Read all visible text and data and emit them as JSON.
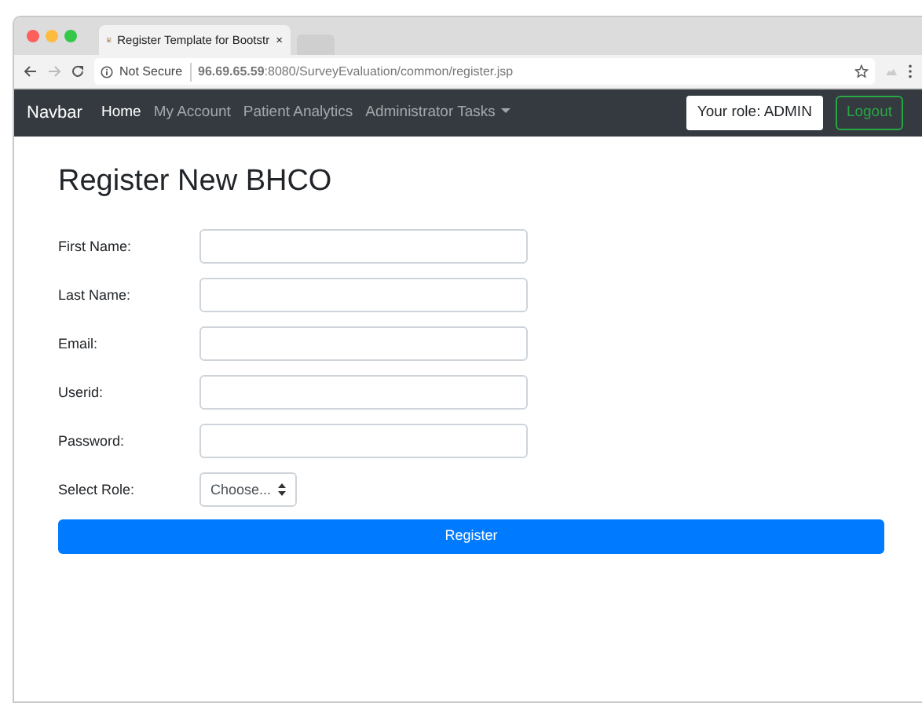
{
  "browser": {
    "tab_title": "Register Template for Bootstr",
    "tab_close": "×",
    "security": "Not Secure",
    "url": "**96.69.65.59**:8080/SurveyEvaluation/common/register.jsp"
  },
  "navbar": {
    "brand": "Navbar",
    "items": [
      {
        "label": "Home",
        "selected": true,
        "kind": "link"
      },
      {
        "label": "My Account",
        "selected": false,
        "kind": "link"
      },
      {
        "label": "Patient Analytics",
        "selected": false,
        "kind": "link"
      },
      {
        "label": "Administrator Tasks",
        "selected": false,
        "kind": "dropdown"
      }
    ],
    "role": "Your role: ADMIN",
    "logout": "Logout"
  },
  "form": {
    "title": "Register New BHCO",
    "fields": [
      {
        "label": "First Name:",
        "kind": "text"
      },
      {
        "label": "Last Name:",
        "kind": "text"
      },
      {
        "label": "Email:",
        "kind": "text"
      },
      {
        "label": "Userid:",
        "kind": "text"
      },
      {
        "label": "Password:",
        "kind": "password"
      },
      {
        "label": "Select Role:",
        "kind": "select",
        "value": "Choose..."
      }
    ],
    "submit": "Register"
  }
}
